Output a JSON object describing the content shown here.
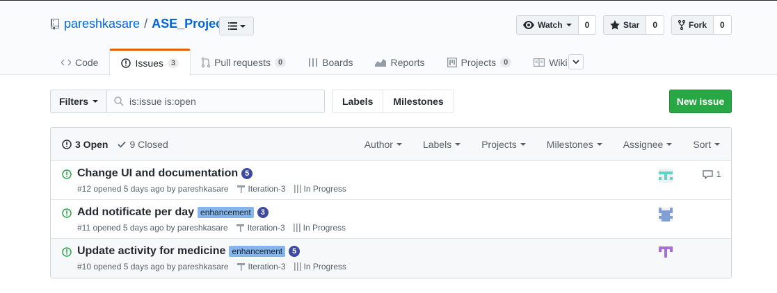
{
  "repo": {
    "owner": "pareshkasare",
    "separator": "/",
    "name": "ASE_Project"
  },
  "social": {
    "watch": {
      "label": "Watch",
      "count": "0"
    },
    "star": {
      "label": "Star",
      "count": "0"
    },
    "fork": {
      "label": "Fork",
      "count": "0"
    }
  },
  "tabs": [
    {
      "label": "Code",
      "icon": "code-icon"
    },
    {
      "label": "Issues",
      "count": "3",
      "icon": "issue-opened-icon",
      "selected": true
    },
    {
      "label": "Pull requests",
      "count": "0",
      "icon": "pull-request-icon"
    },
    {
      "label": "Boards",
      "icon": "boards-icon"
    },
    {
      "label": "Reports",
      "icon": "graph-icon"
    },
    {
      "label": "Projects",
      "count": "0",
      "icon": "project-icon"
    },
    {
      "label": "Wiki",
      "icon": "book-icon"
    }
  ],
  "toolbar": {
    "filters_label": "Filters",
    "search_value": "is:issue is:open",
    "labels_label": "Labels",
    "milestones_label": "Milestones",
    "new_issue_label": "New issue"
  },
  "list_header": {
    "open_label": "3 Open",
    "closed_label": "9 Closed",
    "filters": [
      "Author",
      "Labels",
      "Projects",
      "Milestones",
      "Assignee",
      "Sort"
    ]
  },
  "issues": [
    {
      "title": "Change UI and documentation",
      "label": "",
      "badge": "5",
      "meta": "#12 opened 5 days ago by pareshkasare",
      "milestone": "Iteration-3",
      "status": "In Progress",
      "comments": "1",
      "avatar_color": "#5fd4c4"
    },
    {
      "title": "Add notificate per day",
      "label": "enhancement",
      "badge": "3",
      "meta": "#11 opened 5 days ago by pareshkasare",
      "milestone": "Iteration-3",
      "status": "In Progress",
      "comments": "",
      "avatar_color": "#7f9fd6"
    },
    {
      "title": "Update activity for medicine",
      "label": "enhancement",
      "badge": "5",
      "meta": "#10 opened 5 days ago by pareshkasare",
      "milestone": "Iteration-3",
      "status": "In Progress",
      "comments": "",
      "avatar_color": "#a46fd8"
    }
  ],
  "colors": {
    "accent": "#0366d6",
    "success": "#28a745",
    "tab_active_border": "#e36209",
    "label_enhancement": "#84b6eb"
  }
}
